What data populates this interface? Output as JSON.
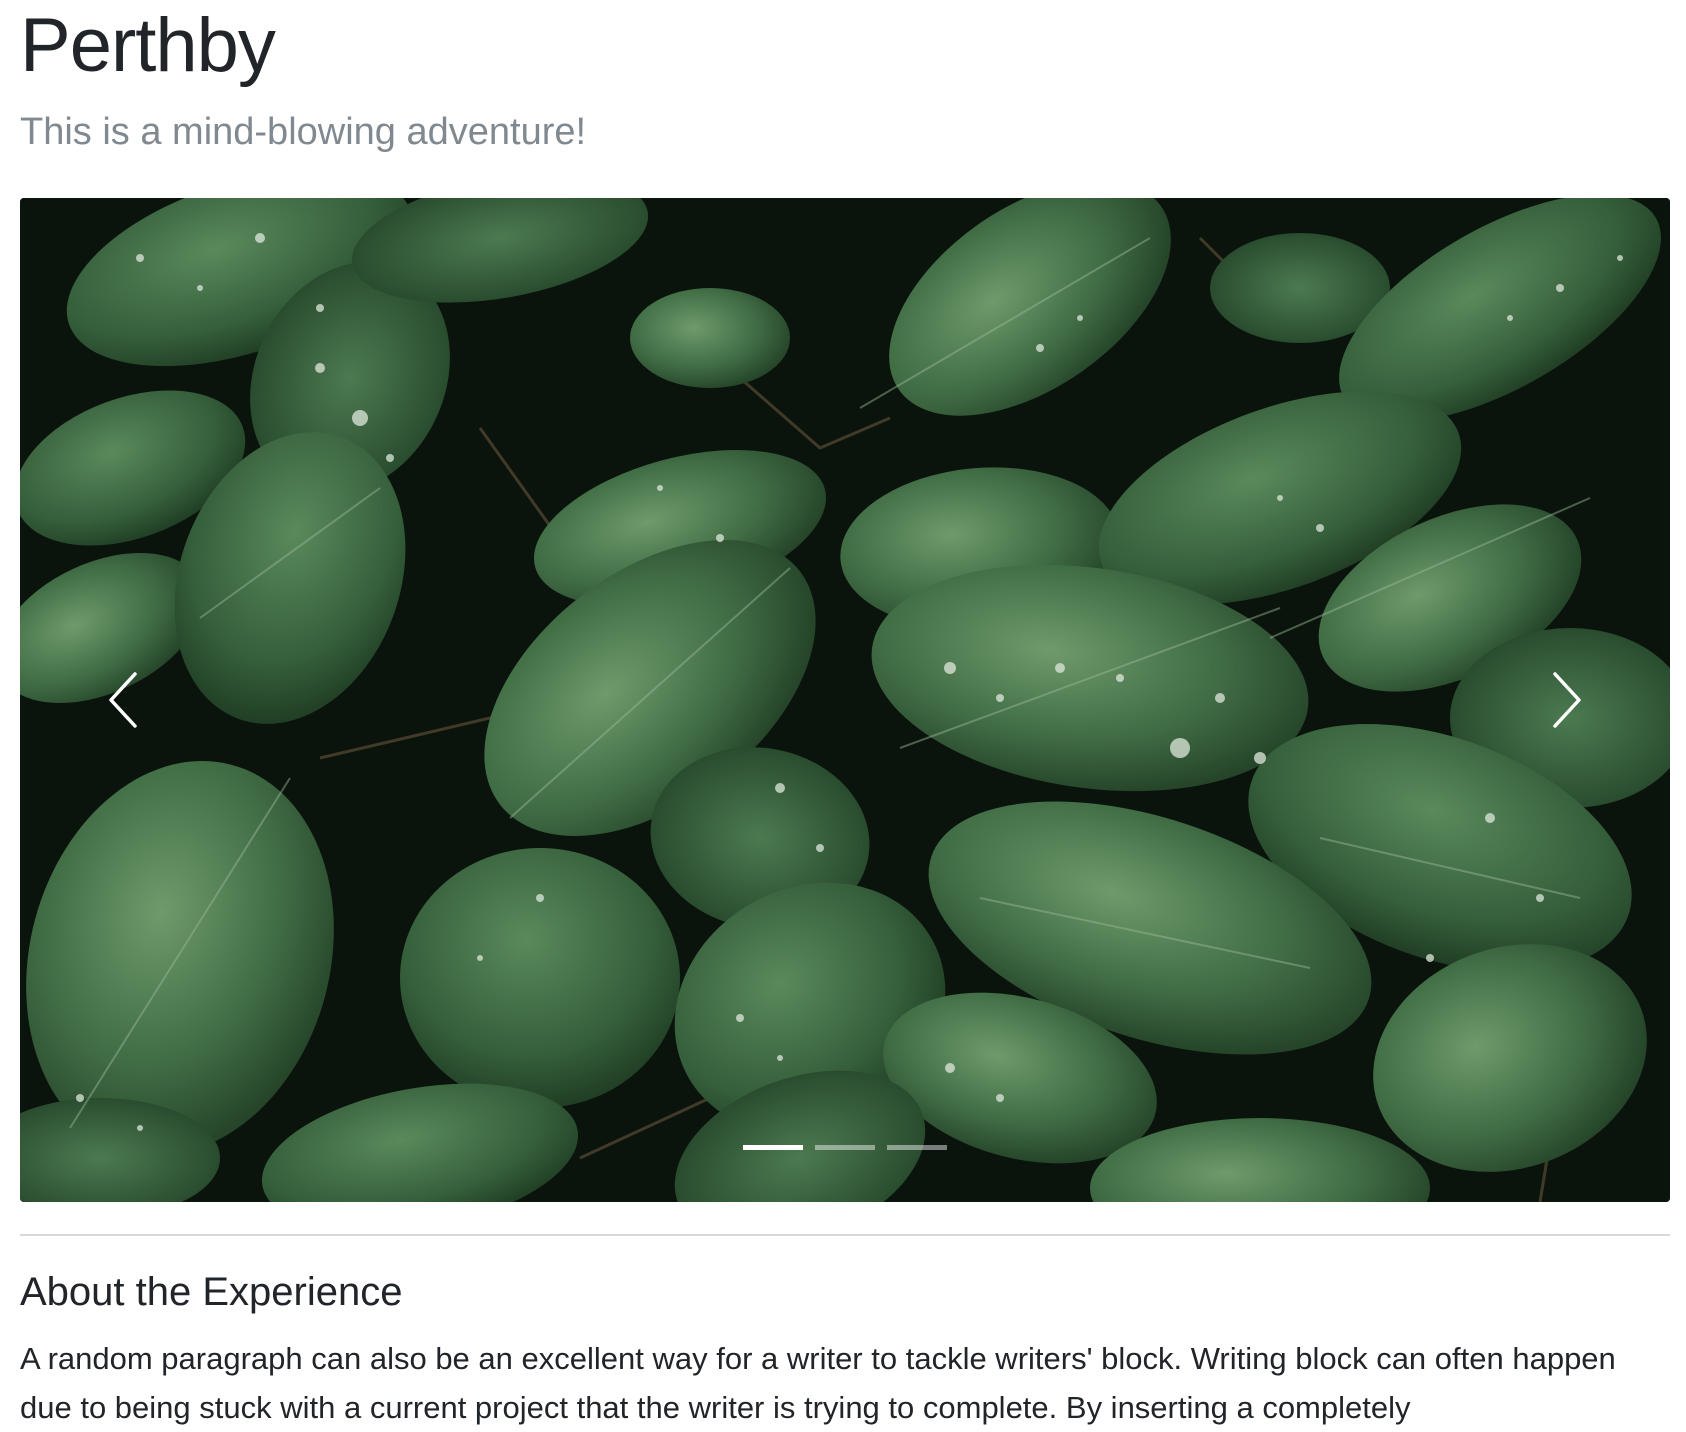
{
  "header": {
    "title": "Perthby",
    "subtitle": "This is a mind-blowing adventure!"
  },
  "carousel": {
    "image_subject": "dark green leaves with water droplets",
    "prev_icon": "chevron-left-icon",
    "next_icon": "chevron-right-icon",
    "slide_count": 3,
    "active_slide": 1
  },
  "about": {
    "heading": "About the Experience",
    "paragraph": "A random paragraph can also be an excellent way for a writer to tackle writers' block. Writing block can often happen due to being stuck with a current project that the writer is trying to complete. By inserting a completely"
  },
  "colors": {
    "text": "#212529",
    "muted": "#6c757d",
    "divider": "#d6d8db",
    "leaf_dark": "#1f3a24",
    "leaf_mid": "#3f6b45",
    "leaf_light": "#5e8a5f"
  }
}
